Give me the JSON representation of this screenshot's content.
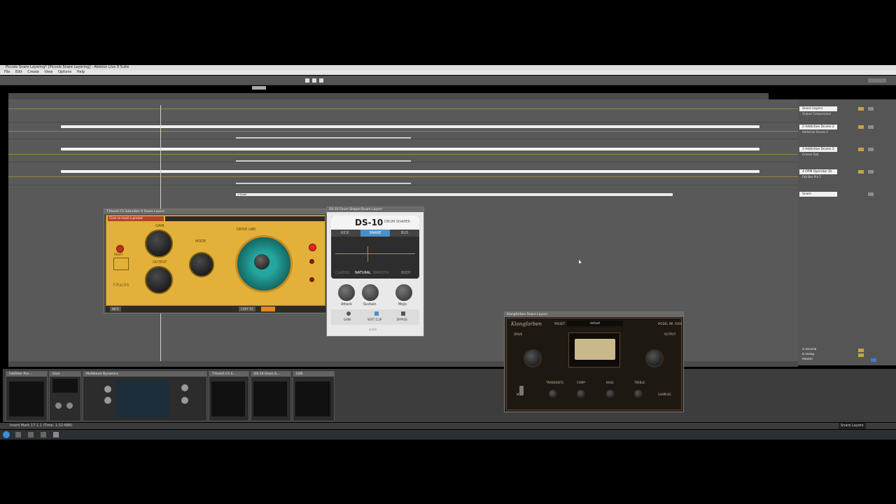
{
  "window": {
    "title": "Piccolo Snare Layering* [Piccolo Snare Layering] - Ableton Live 9 Suite",
    "menu": [
      "File",
      "Edit",
      "Create",
      "View",
      "Options",
      "Help"
    ]
  },
  "arrangement": {
    "mixer_tracks": [
      {
        "name": "Snare Layers",
        "sub": "Output Compression"
      },
      {
        "name": "2 Addictive Drums 2",
        "sub": "Addictive Drums 2"
      },
      {
        "name": "3 Addictive Drums 2",
        "sub": "Groove Tool"
      },
      {
        "name": "4 OPM Operator Dr",
        "sub": "Fab Bus Pro 1"
      },
      {
        "name": "Snare"
      }
    ],
    "returns": [
      "A Reverb",
      "B Delay",
      "Master"
    ],
    "clip_label": "1 Snare"
  },
  "plugins": {
    "tracks": {
      "title": "T-RackS CS Saturator X Snare Layers",
      "preset_prompt": "Click to load a preset",
      "labels": {
        "gain": "GAIN",
        "output": "OUTPUT",
        "mode": "MODE",
        "drive": "DRIVE (dB)",
        "reset": "RESET",
        "brand": "T-RackS",
        "footer_left": "INFO",
        "footer_right": "COPY TO"
      }
    },
    "ds10": {
      "title": "DS-10 Drum Shaper/Snare Layers",
      "logo": "DS-10",
      "logo_sub": "DRUM SHAPER",
      "tabs": [
        "KICK",
        "SNARE",
        "BUS"
      ],
      "modes": [
        "CLASSIC",
        "NATURAL",
        "SMOOTH",
        "BODY"
      ],
      "knobs": [
        "Attack",
        "Sustain",
        "Mojo"
      ],
      "bottom": [
        "GAIN",
        "SOFT CLIP",
        "BYPASS"
      ],
      "brand": "audio"
    },
    "kc": {
      "title": "Klangfarben Snare Layers",
      "logo": "Klangfarben",
      "preset_label": "PRESET",
      "preset_value": "default",
      "model": "MODEL NR. 5000",
      "labels": [
        "DRIVE",
        "OUTPUT",
        "TRANSIENTS",
        "COMP",
        "BASS",
        "TREBLE",
        "SAMPLES",
        "MIX"
      ]
    }
  },
  "devices": [
    {
      "name": "FabFilter Pro-..."
    },
    {
      "name": "Glue"
    },
    {
      "name": "Multiband Dynamics"
    },
    {
      "name": "T-RackS CS S..."
    },
    {
      "name": "DS-10 Drum S..."
    },
    {
      "name": "EQ8"
    }
  ],
  "status": {
    "left": "Insert Mark 17.1.1 (Time: 1:32:688)",
    "right": "Snare Layers"
  },
  "colors": {
    "accent_yellow": "#e3b13a",
    "teal": "#1f8c88",
    "daw_bg": "#595959"
  }
}
